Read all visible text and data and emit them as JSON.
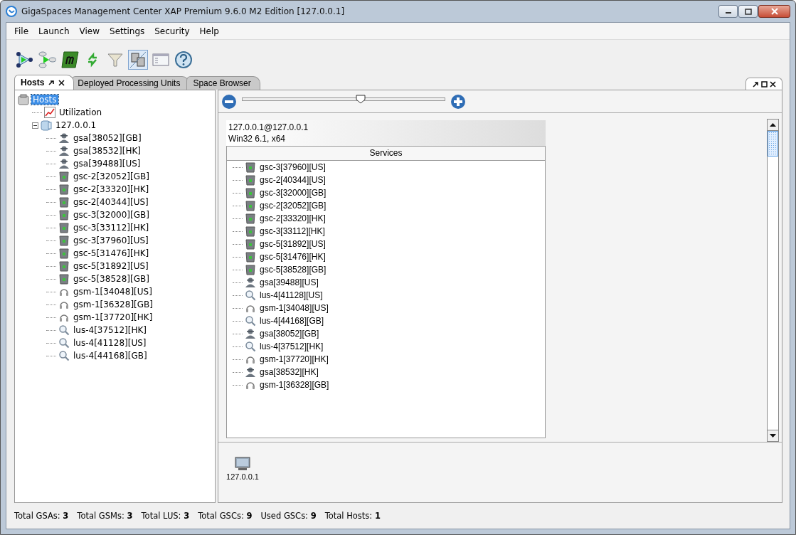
{
  "window": {
    "title": "GigaSpaces Management Center XAP Premium 9.6.0 M2 Edition  [127.0.0.1]"
  },
  "menu": [
    {
      "label": "File"
    },
    {
      "label": "Launch"
    },
    {
      "label": "View"
    },
    {
      "label": "Settings"
    },
    {
      "label": "Security"
    },
    {
      "label": "Help"
    }
  ],
  "toolbar": [
    {
      "kind": "deploy",
      "selected": false
    },
    {
      "kind": "deploy-pu",
      "selected": false
    },
    {
      "kind": "m",
      "selected": false
    },
    {
      "kind": "refresh",
      "selected": false
    },
    {
      "kind": "filter",
      "selected": false
    },
    {
      "kind": "toggle",
      "selected": true
    },
    {
      "kind": "window",
      "selected": false
    },
    {
      "kind": "help",
      "selected": false
    }
  ],
  "tabs": [
    {
      "label": "Hosts",
      "selected": true
    },
    {
      "label": "Deployed Processing Units",
      "selected": false
    },
    {
      "label": "Space Browser",
      "selected": false
    }
  ],
  "tree": {
    "label": "Hosts",
    "kind": "hosts",
    "selected": true,
    "children": [
      {
        "label": "Utilization",
        "kind": "chart",
        "selected": false
      },
      {
        "label": "127.0.0.1",
        "kind": "host",
        "selected": false,
        "expanded": true,
        "children": [
          {
            "label": "gsa[38052][GB]",
            "kind": "gsa",
            "selected": false
          },
          {
            "label": "gsa[38532][HK]",
            "kind": "gsa",
            "selected": false
          },
          {
            "label": "gsa[39488][US]",
            "kind": "gsa",
            "selected": false
          },
          {
            "label": "gsc-2[32052][GB]",
            "kind": "gsc",
            "selected": false
          },
          {
            "label": "gsc-2[33320][HK]",
            "kind": "gsc",
            "selected": false
          },
          {
            "label": "gsc-2[40344][US]",
            "kind": "gsc",
            "selected": false
          },
          {
            "label": "gsc-3[32000][GB]",
            "kind": "gsc",
            "selected": false
          },
          {
            "label": "gsc-3[33112][HK]",
            "kind": "gsc",
            "selected": false
          },
          {
            "label": "gsc-3[37960][US]",
            "kind": "gsc",
            "selected": false
          },
          {
            "label": "gsc-5[31476][HK]",
            "kind": "gsc",
            "selected": false
          },
          {
            "label": "gsc-5[31892][US]",
            "kind": "gsc",
            "selected": false
          },
          {
            "label": "gsc-5[38528][GB]",
            "kind": "gsc",
            "selected": false
          },
          {
            "label": "gsm-1[34048][US]",
            "kind": "gsm",
            "selected": false
          },
          {
            "label": "gsm-1[36328][GB]",
            "kind": "gsm",
            "selected": false
          },
          {
            "label": "gsm-1[37720][HK]",
            "kind": "gsm",
            "selected": false
          },
          {
            "label": "lus-4[37512][HK]",
            "kind": "lus",
            "selected": false
          },
          {
            "label": "lus-4[41128][US]",
            "kind": "lus",
            "selected": false
          },
          {
            "label": "lus-4[44168][GB]",
            "kind": "lus",
            "selected": false
          }
        ]
      }
    ]
  },
  "zoom_slider": {
    "level": 0.586
  },
  "host_card": {
    "title": "127.0.0.1@127.0.0.1",
    "subtitle": "Win32 6.1, x64",
    "services_header": "Services",
    "services": [
      {
        "label": "gsc-3[37960][US]",
        "kind": "gsc"
      },
      {
        "label": "gsc-2[40344][US]",
        "kind": "gsc"
      },
      {
        "label": "gsc-3[32000][GB]",
        "kind": "gsc"
      },
      {
        "label": "gsc-2[32052][GB]",
        "kind": "gsc"
      },
      {
        "label": "gsc-2[33320][HK]",
        "kind": "gsc"
      },
      {
        "label": "gsc-3[33112][HK]",
        "kind": "gsc"
      },
      {
        "label": "gsc-5[31892][US]",
        "kind": "gsc"
      },
      {
        "label": "gsc-5[31476][HK]",
        "kind": "gsc"
      },
      {
        "label": "gsc-5[38528][GB]",
        "kind": "gsc"
      },
      {
        "label": "gsa[39488][US]",
        "kind": "gsa"
      },
      {
        "label": "lus-4[41128][US]",
        "kind": "lus"
      },
      {
        "label": "gsm-1[34048][US]",
        "kind": "gsm"
      },
      {
        "label": "lus-4[44168][GB]",
        "kind": "lus"
      },
      {
        "label": "gsa[38052][GB]",
        "kind": "gsa"
      },
      {
        "label": "lus-4[37512][HK]",
        "kind": "lus"
      },
      {
        "label": "gsm-1[37720][HK]",
        "kind": "gsm"
      },
      {
        "label": "gsa[38532][HK]",
        "kind": "gsa"
      },
      {
        "label": "gsm-1[36328][GB]",
        "kind": "gsm"
      }
    ]
  },
  "host_node": {
    "label": "127.0.0.1"
  },
  "status_bar": [
    {
      "label": "Total GSAs:",
      "value": "3"
    },
    {
      "label": "Total GSMs:",
      "value": "3"
    },
    {
      "label": "Total LUS:",
      "value": "3"
    },
    {
      "label": "Total GSCs:",
      "value": "9"
    },
    {
      "label": "Used GSCs:",
      "value": "9"
    },
    {
      "label": "Total Hosts:",
      "value": "1"
    }
  ]
}
